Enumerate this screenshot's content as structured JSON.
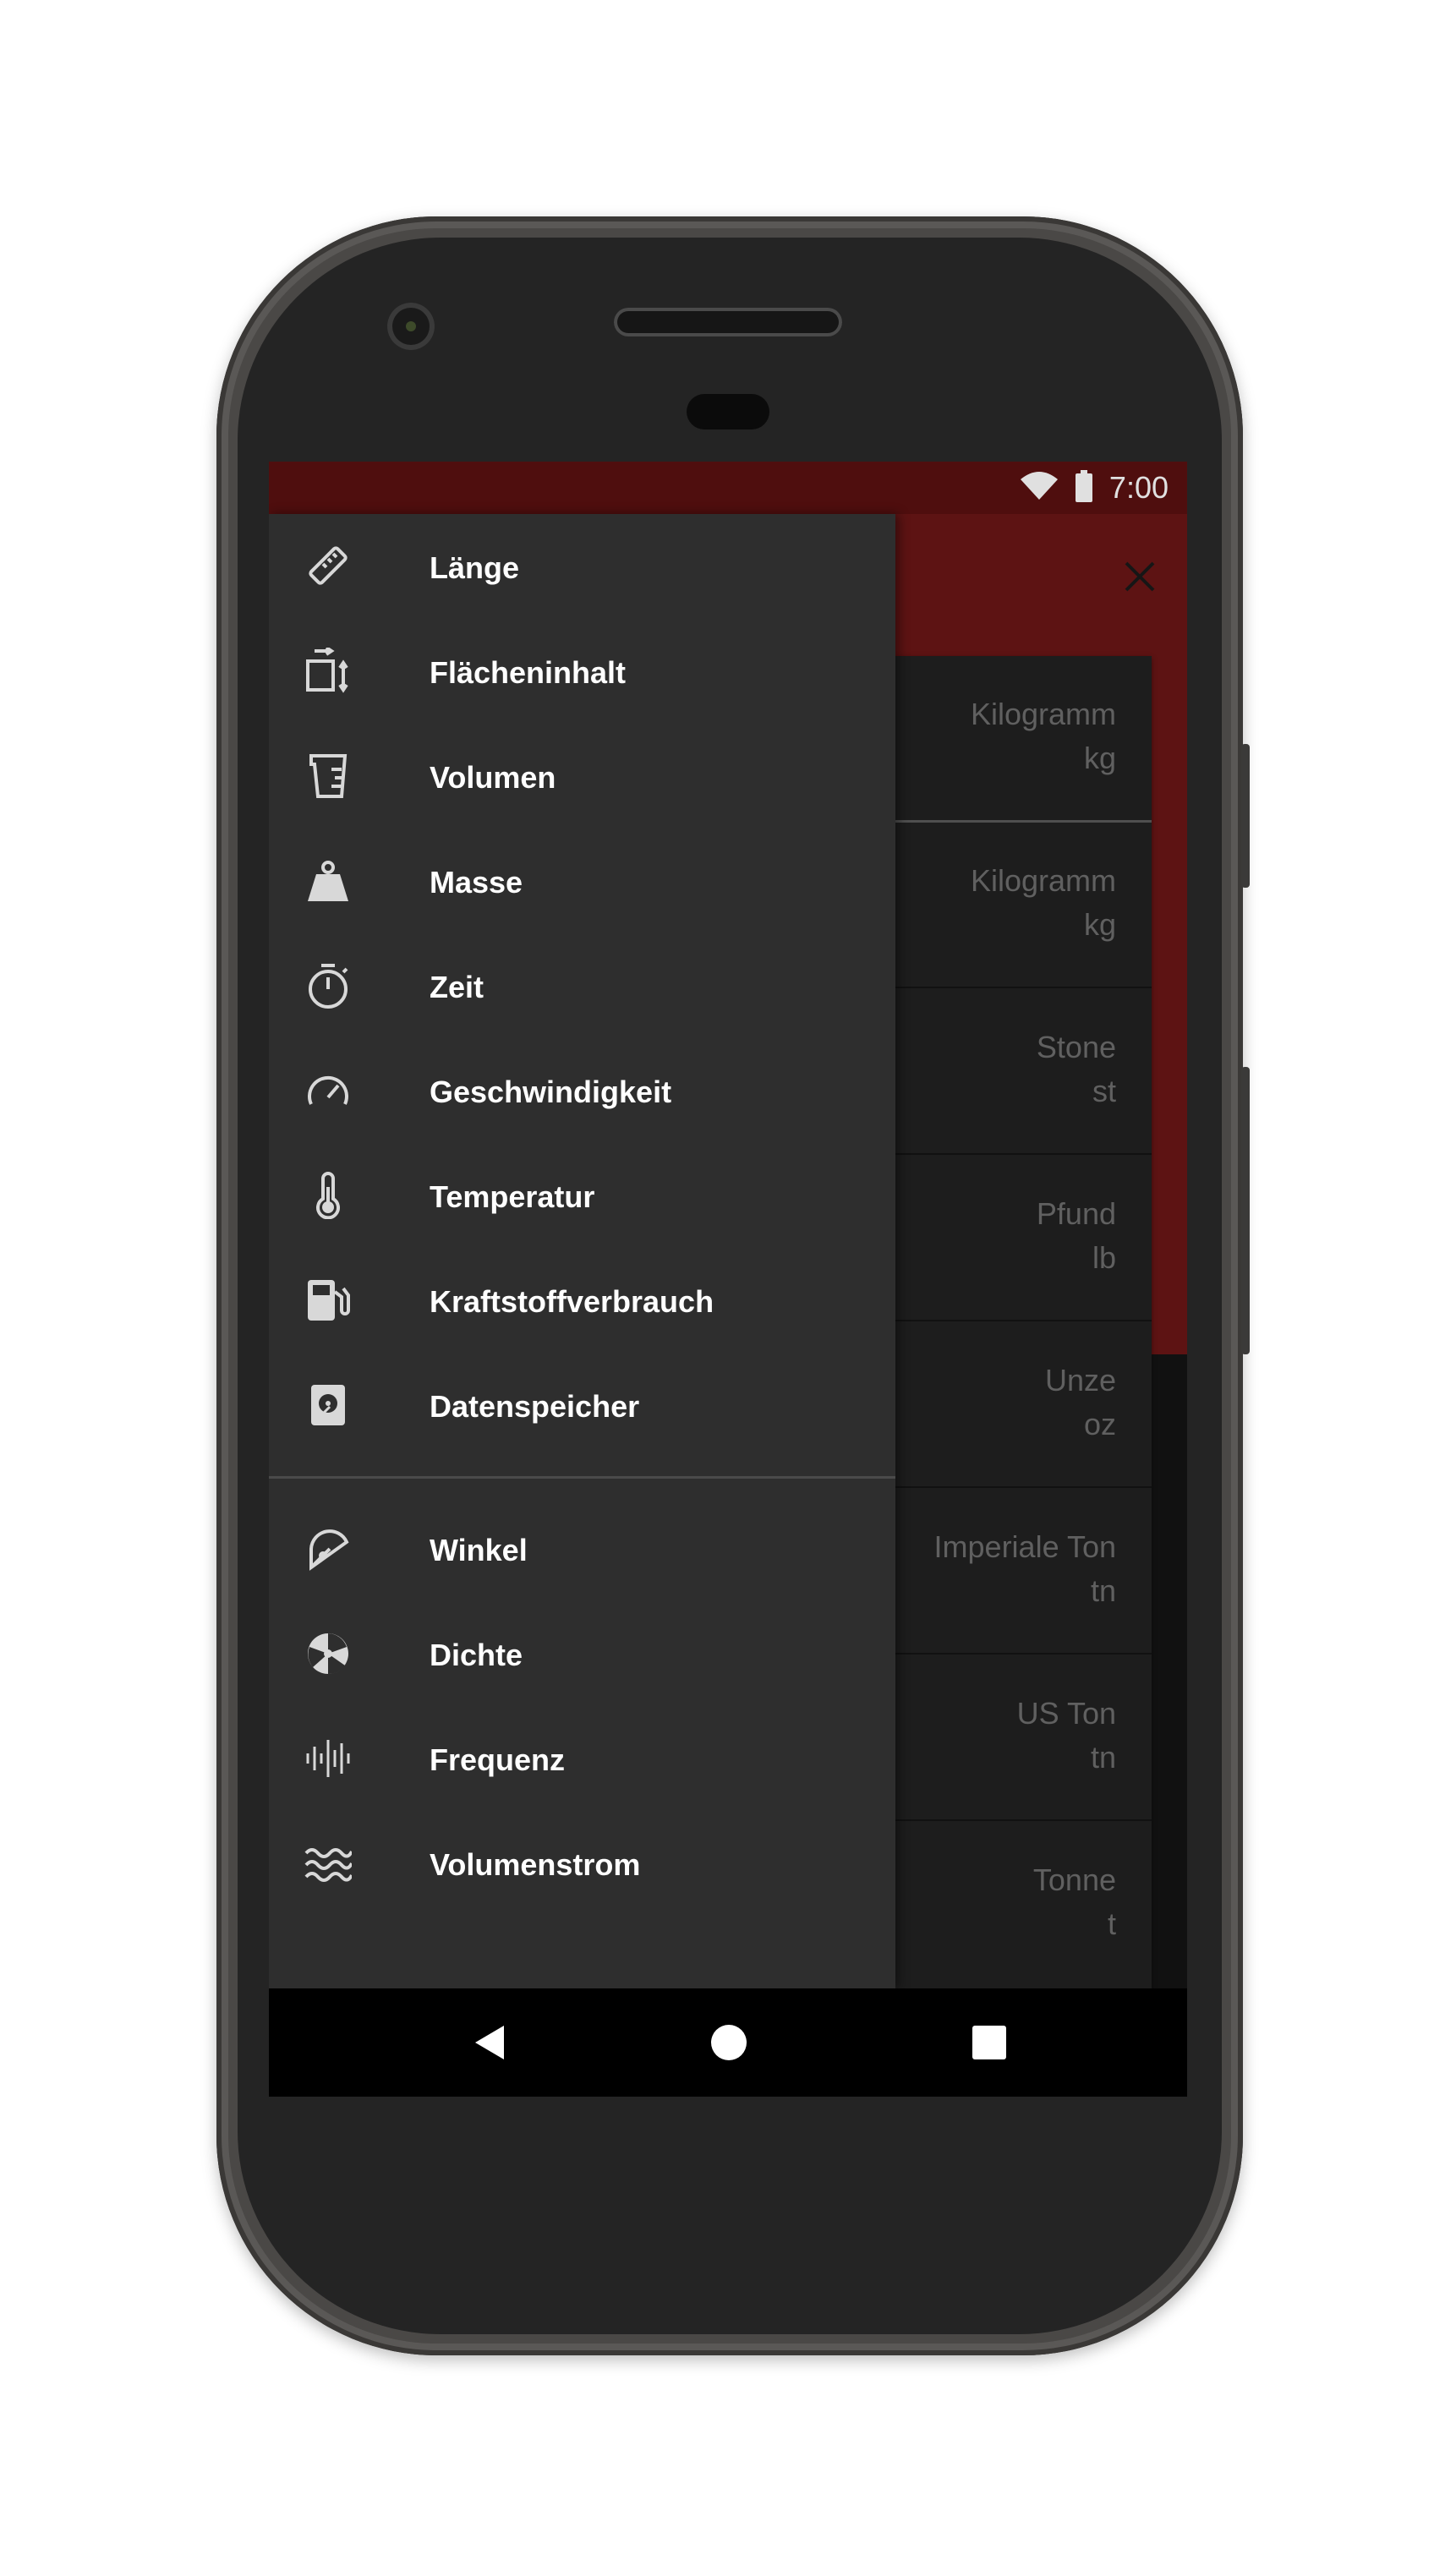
{
  "status_bar": {
    "time": "7:00",
    "wifi_icon": "wifi-icon",
    "battery_icon": "battery-icon"
  },
  "app_bar": {
    "close_icon": "close-icon",
    "accent_color": "#6a1616"
  },
  "drawer": {
    "primary_items": [
      {
        "label": "Länge",
        "icon": "ruler-icon"
      },
      {
        "label": "Flächeninhalt",
        "icon": "area-icon"
      },
      {
        "label": "Volumen",
        "icon": "measuring-cup-icon"
      },
      {
        "label": "Masse",
        "icon": "weight-icon"
      },
      {
        "label": "Zeit",
        "icon": "stopwatch-icon"
      },
      {
        "label": "Geschwindigkeit",
        "icon": "speedometer-icon"
      },
      {
        "label": "Temperatur",
        "icon": "thermometer-icon"
      },
      {
        "label": "Kraftstoffverbrauch",
        "icon": "fuel-pump-icon"
      },
      {
        "label": "Datenspeicher",
        "icon": "hard-drive-icon"
      }
    ],
    "secondary_items": [
      {
        "label": "Winkel",
        "icon": "protractor-icon"
      },
      {
        "label": "Dichte",
        "icon": "density-icon"
      },
      {
        "label": "Frequenz",
        "icon": "waveform-icon"
      },
      {
        "label": "Volumenstrom",
        "icon": "waves-icon"
      }
    ]
  },
  "units": [
    {
      "name": "Kilogramm",
      "symbol": "kg"
    },
    {
      "name": "Kilogramm",
      "symbol": "kg"
    },
    {
      "name": "Stone",
      "symbol": "st"
    },
    {
      "name": "Pfund",
      "symbol": "lb"
    },
    {
      "name": "Unze",
      "symbol": "oz"
    },
    {
      "name": "Imperiale Ton",
      "symbol": "tn"
    },
    {
      "name": "US Ton",
      "symbol": "tn"
    },
    {
      "name": "Tonne",
      "symbol": "t"
    }
  ],
  "nav_bar": {
    "back_icon": "back-icon",
    "home_icon": "home-icon",
    "recents_icon": "recents-icon"
  }
}
